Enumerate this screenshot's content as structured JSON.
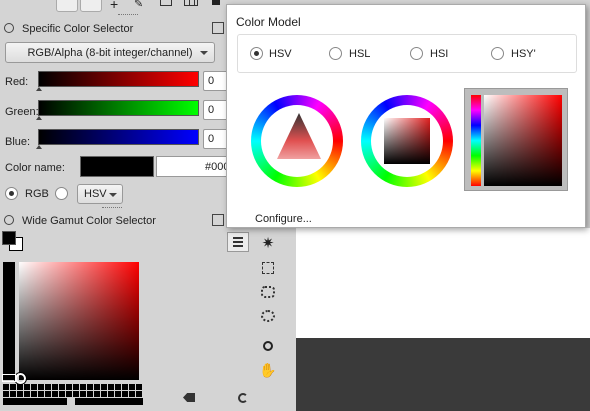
{
  "specific": {
    "title": "Specific Color Selector",
    "model_dropdown": "RGB/Alpha (8-bit integer/channel)",
    "channels": [
      {
        "label": "Red:",
        "value": "0",
        "color": "#ff0000"
      },
      {
        "label": "Green:",
        "value": "0",
        "color": "#00ff00"
      },
      {
        "label": "Blue:",
        "value": "0",
        "color": "#0000ff"
      }
    ],
    "color_name_label": "Color name:",
    "color_name_value": "#000",
    "rgb_label": "RGB",
    "hsv_option": "HSV"
  },
  "wide_gamut": {
    "title": "Wide Gamut Color Selector",
    "accent": "#ff0000"
  },
  "popup": {
    "title": "Color Model",
    "models": [
      {
        "label": "HSV",
        "selected": true
      },
      {
        "label": "HSL",
        "selected": false
      },
      {
        "label": "HSI",
        "selected": false
      },
      {
        "label": "HSY'",
        "selected": false
      }
    ],
    "configure": "Configure..."
  },
  "toolbox_icons": [
    "fuzzy-select-icon",
    "color-picker-select-icon",
    "free-select-icon",
    "lasso-select-icon",
    "zoom-icon",
    "pan-icon"
  ]
}
